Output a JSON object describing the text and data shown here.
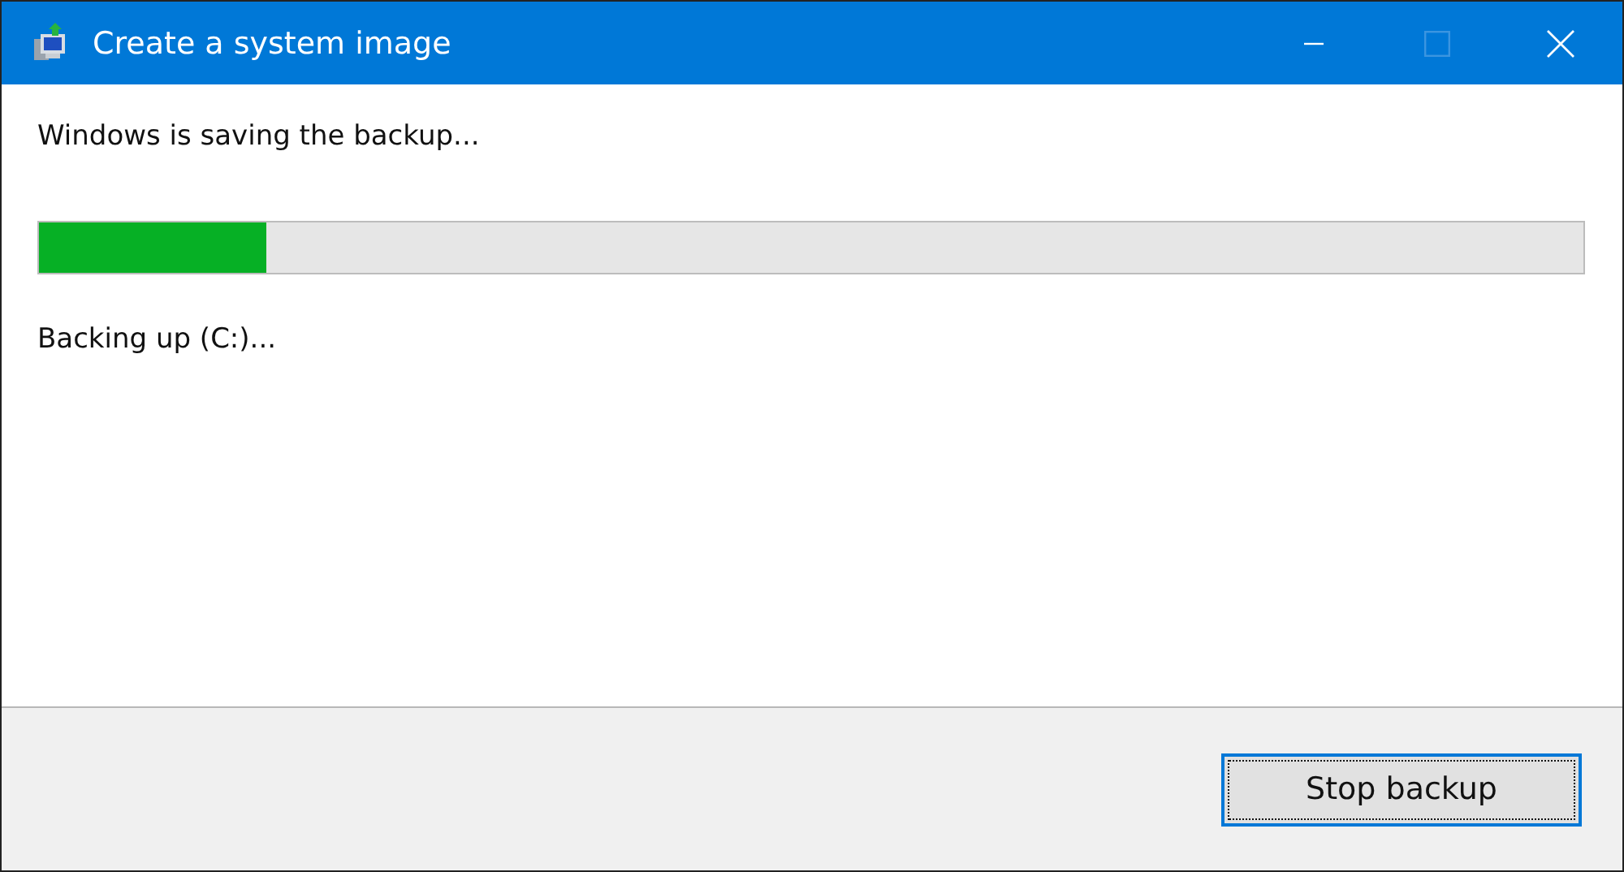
{
  "window": {
    "title": "Create a system image",
    "controls": [
      {
        "kind": "minimize",
        "disabled": false
      },
      {
        "kind": "maximize",
        "disabled": true
      },
      {
        "kind": "close",
        "disabled": false
      }
    ]
  },
  "heading": "Windows is saving the backup...",
  "progress": {
    "level": 0.147
  },
  "status": "Backing up (C:)...",
  "buttons": [
    {
      "label": "Stop backup",
      "focused": true
    }
  ]
}
